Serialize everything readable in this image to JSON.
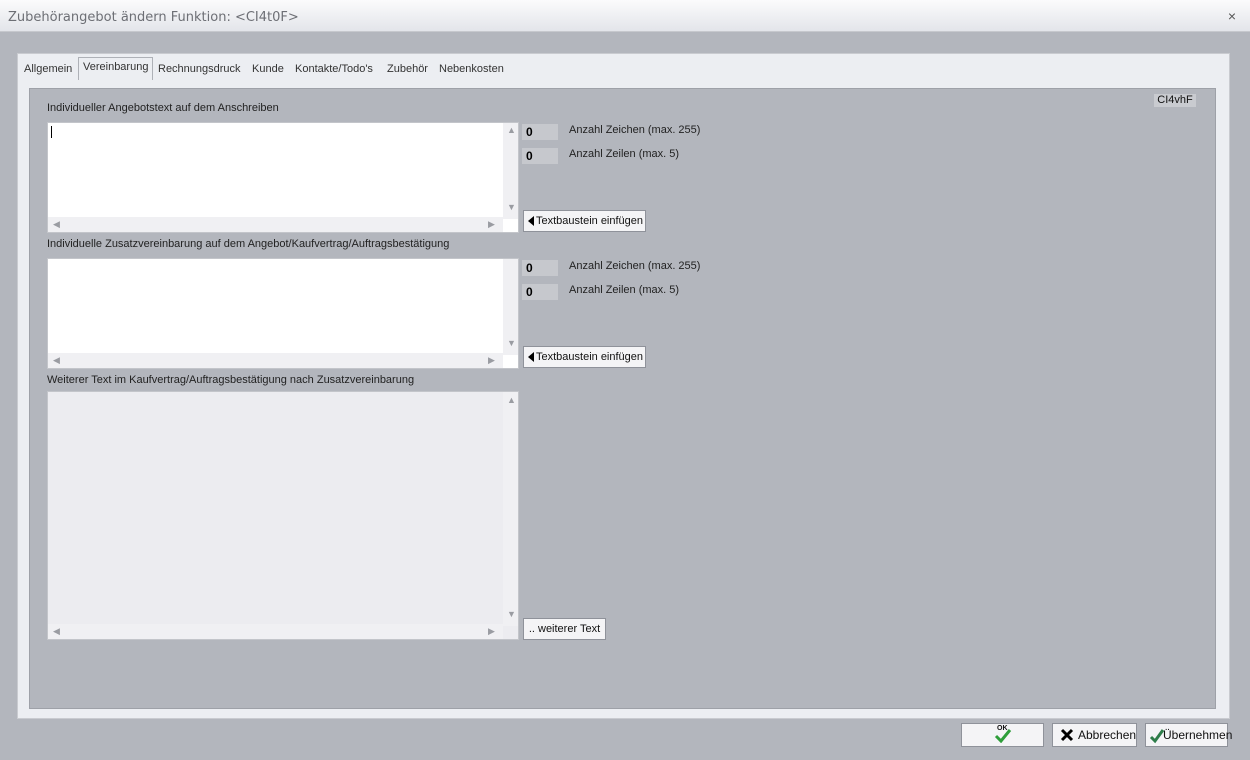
{
  "window": {
    "title": "Zubehörangebot ändern Funktion: <CI4t0F>",
    "close": "×"
  },
  "tabs": [
    {
      "label": "Allgemein"
    },
    {
      "label": "Vereinbarung"
    },
    {
      "label": "Rechnungsdruck"
    },
    {
      "label": "Kunde"
    },
    {
      "label": "Kontakte/Todo's"
    },
    {
      "label": "Zubehör"
    },
    {
      "label": "Nebenkosten"
    }
  ],
  "panel": {
    "id_badge": "CI4vhF",
    "section1": {
      "label": "Individueller Angebotstext auf dem Anschreiben",
      "chars_count": "0",
      "chars_label": "Anzahl Zeichen (max. 255)",
      "lines_count": "0",
      "lines_label": "Anzahl Zeilen (max. 5)",
      "button": "Textbaustein einfügen"
    },
    "section2": {
      "label": "Individuelle Zusatzvereinbarung auf dem Angebot/Kaufvertrag/Auftragsbestätigung",
      "chars_count": "0",
      "chars_label": "Anzahl Zeichen (max. 255)",
      "lines_count": "0",
      "lines_label": "Anzahl Zeilen (max. 5)",
      "button": "Textbaustein einfügen"
    },
    "section3": {
      "label": "Weiterer Text im Kaufvertrag/Auftragsbestätigung nach Zusatzvereinbarung",
      "button": ".. weiterer Text"
    }
  },
  "footer": {
    "ok": "OK",
    "cancel": "Abbrechen",
    "apply": "Übernehmen"
  },
  "colors": {
    "background": "#b3b6bd",
    "frame": "#eceef2",
    "ok_check": "#2e9e3a"
  },
  "icons": {
    "ok": "check-ok-icon",
    "cancel": "x-icon",
    "apply": "check-icon",
    "insert": "triangle-left-icon"
  }
}
